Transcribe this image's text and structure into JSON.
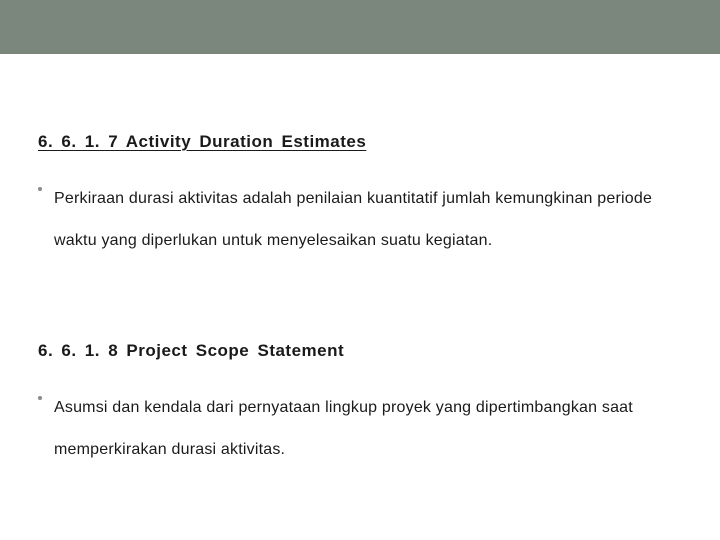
{
  "sections": [
    {
      "heading": "6. 6. 1. 7 Activity Duration Estimates",
      "underline": true,
      "bullet": "Perkiraan durasi aktivitas adalah penilaian kuantitatif jumlah kemungkinan periode waktu yang diperlukan untuk menyelesaikan suatu kegiatan."
    },
    {
      "heading": "6. 6. 1. 8 Project Scope Statement",
      "underline": false,
      "bullet": "Asumsi dan kendala dari pernyataan lingkup proyek yang dipertimbangkan saat memperkirakan durasi aktivitas."
    }
  ]
}
